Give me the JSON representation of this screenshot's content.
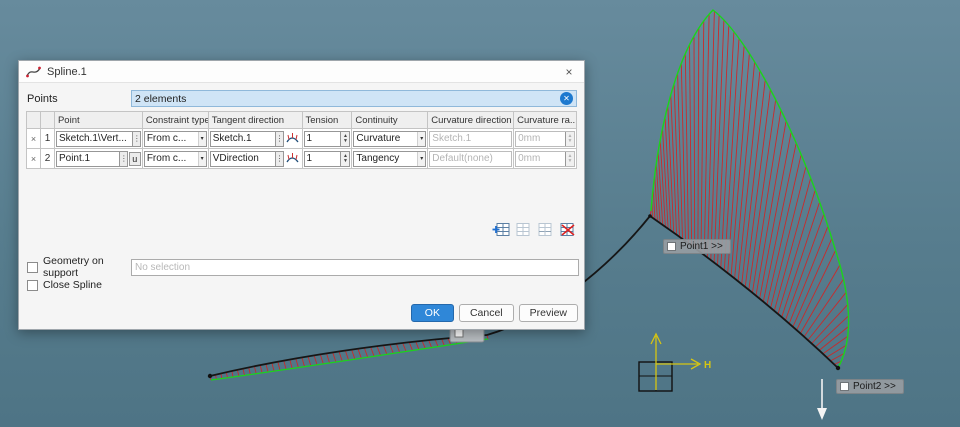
{
  "viewport": {
    "point1_label": "Point1 >>",
    "point2_label": "Point2 >>",
    "axis_h_label": "H",
    "colors": {
      "spline": "#161616",
      "envelope_green": "#1bd41b",
      "comb_red": "#cf2626",
      "axis_yellow": "#d6c512",
      "arrow_white": "#f4f4f4"
    }
  },
  "icons": {
    "handle": "⋮",
    "dropdown": "▾",
    "up": "▲",
    "down": "▼",
    "clear": "✕",
    "close": "×"
  },
  "dialog": {
    "title": "Spline.1",
    "points_label": "Points",
    "points_value": "2 elements",
    "table": {
      "headers": [
        "",
        "",
        "Point",
        "Constraint type",
        "Tangent direction",
        "Tension",
        "Continuity",
        "Curvature direction",
        "Curvature ra..."
      ],
      "rows": [
        {
          "remove": "×",
          "num": "1",
          "point": "Sketch.1\\Vert...",
          "constraint": "From c...",
          "tangent": "Sketch.1",
          "tension": "1",
          "continuity": "Curvature",
          "curv_dir": "Sketch.1",
          "curv_radius": "0mm"
        },
        {
          "remove": "×",
          "num": "2",
          "point": "Point.1",
          "point_extra": "u",
          "constraint": "From c...",
          "tangent": "VDirection",
          "tension": "1",
          "continuity": "Tangency",
          "curv_dir": "Default(none)",
          "curv_radius": "0mm"
        }
      ]
    },
    "geometry_on_support_label": "Geometry on support",
    "geometry_on_support_value": "No selection",
    "close_spline_label": "Close Spline",
    "buttons": {
      "ok": "OK",
      "cancel": "Cancel",
      "preview": "Preview"
    },
    "accent_blue": "#2f87d8",
    "highlight_blue": "#cfe4f6"
  }
}
